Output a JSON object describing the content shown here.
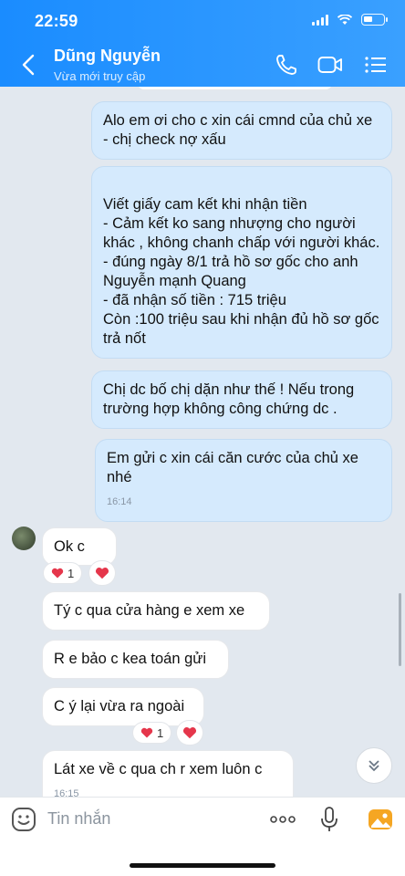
{
  "status_bar": {
    "time": "22:59"
  },
  "header": {
    "contact_name": "Dũng Nguyễn",
    "contact_status": "Vừa mới truy cập",
    "icons": [
      "back-icon",
      "phone-icon",
      "video-call-icon",
      "menu-list-icon"
    ]
  },
  "messages": [
    {
      "direction": "outgoing",
      "text": "Alo em ơi cho c xin cái cmnd của chủ xe - chị check nợ xấu"
    },
    {
      "direction": "outgoing",
      "text": "Viết giấy cam kết khi nhận tiền\n- Cảm kết ko sang nhượng cho người khác , không chanh chấp với người khác.\n- đúng ngày 8/1 trả hồ sơ gốc cho anh Nguyễn mạnh Quang\n- đã nhận số tiền : 715 triệu\nCòn :100 triệu sau khi nhận đủ hồ sơ gốc trả nốt"
    },
    {
      "direction": "outgoing",
      "text": "Chị dc bố chị dặn như thế ! Nếu trong trường hợp không công chứng dc ."
    },
    {
      "direction": "outgoing",
      "text": "Em gửi c xin cái căn cước của chủ xe nhé",
      "time": "16:14"
    },
    {
      "direction": "incoming",
      "text": "Ok c",
      "reaction_count": "1"
    },
    {
      "direction": "incoming",
      "text": "Tý c qua cửa hàng e xem xe"
    },
    {
      "direction": "incoming",
      "text": "R e bảo c kea toán gửi"
    },
    {
      "direction": "incoming",
      "text": "C ý lại vừa ra ngoài",
      "reaction_count": "1"
    },
    {
      "direction": "incoming",
      "text": "Lát xe về c qua ch r xem luôn c",
      "time": "16:15"
    }
  ],
  "input": {
    "placeholder": "Tin nhắn"
  },
  "colors": {
    "header": "#1a8cff",
    "outgoing_bubble": "#d5eafd",
    "incoming_bubble": "#ffffff",
    "heart": "#e5364b"
  }
}
